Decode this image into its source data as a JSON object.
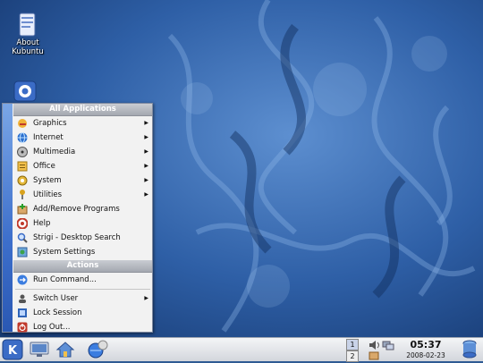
{
  "desktop": {
    "icons": [
      {
        "label_line1": "About",
        "label_line2": "Kubuntu",
        "icon": "document-icon"
      },
      {
        "label_line1": "",
        "label_line2": "",
        "icon": "kmenu-logo-icon"
      }
    ]
  },
  "kmenu": {
    "header_apps": "All Applications",
    "header_actions": "Actions",
    "apps": [
      {
        "label": "Graphics",
        "icon": "graphics-icon",
        "submenu": true
      },
      {
        "label": "Internet",
        "icon": "globe-icon",
        "submenu": true
      },
      {
        "label": "Multimedia",
        "icon": "multimedia-icon",
        "submenu": true
      },
      {
        "label": "Office",
        "icon": "office-icon",
        "submenu": true
      },
      {
        "label": "System",
        "icon": "system-icon",
        "submenu": true
      },
      {
        "label": "Utilities",
        "icon": "utilities-icon",
        "submenu": true
      },
      {
        "label": "Add/Remove Programs",
        "icon": "add-remove-icon",
        "submenu": false
      },
      {
        "label": "Help",
        "icon": "help-icon",
        "submenu": false
      },
      {
        "label": "Strigi - Desktop Search",
        "icon": "search-icon",
        "submenu": false
      },
      {
        "label": "System Settings",
        "icon": "settings-icon",
        "submenu": false
      }
    ],
    "actions": [
      {
        "label": "Run Command...",
        "icon": "run-icon",
        "submenu": false
      },
      {
        "label": "Switch User",
        "icon": "switch-user-icon",
        "submenu": true
      },
      {
        "label": "Lock Session",
        "icon": "lock-icon",
        "submenu": false
      },
      {
        "label": "Log Out...",
        "icon": "logout-icon",
        "submenu": false
      }
    ],
    "submenu_arrow": "▶"
  },
  "taskbar": {
    "pager": [
      "1",
      "2"
    ],
    "clock_time": "05:37",
    "clock_date": "2008-02-23"
  },
  "colors": {
    "wallpaper": "#2f5b94",
    "menu_sidebar": "#3d6fcb",
    "menu_header": "#a4a8b0"
  }
}
